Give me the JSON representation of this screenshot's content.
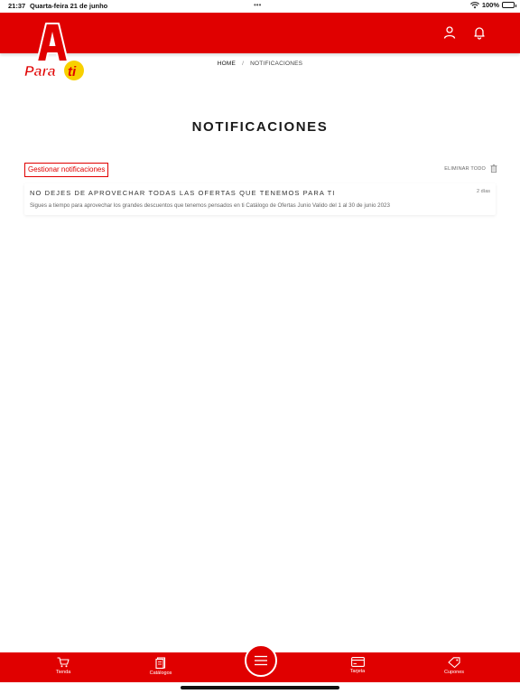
{
  "status_bar": {
    "time": "21:37",
    "date": "Quarta-feira 21 de junho",
    "dots": "•••",
    "battery": "100%"
  },
  "header": {
    "logo_letter": "A",
    "logo_text": "Para ti",
    "brand_color": "#e00000"
  },
  "breadcrumb": {
    "home": "HOME",
    "separator": "/",
    "current": "NOTIFICACIONES"
  },
  "page": {
    "title": "NOTIFICACIONES",
    "manage_label": "Gestionar notificaciones",
    "delete_all_label": "ELIMINAR TODO"
  },
  "notifications": [
    {
      "title": "NO DEJES DE APROVECHAR TODAS LAS OFERTAS QUE TENEMOS PARA TI",
      "time": "2 días",
      "body": "Sigues a tiempo para aprovechar los grandes descuentos que tenemos pensados en ti Catálogo de Ofertas Junio Valido del 1 al 30 de junio 2023"
    }
  ],
  "bottom_nav": {
    "tienda": "Tienda",
    "catalogos": "Catálogos",
    "tarjeta": "Tarjeta",
    "cupones": "Cupones"
  }
}
